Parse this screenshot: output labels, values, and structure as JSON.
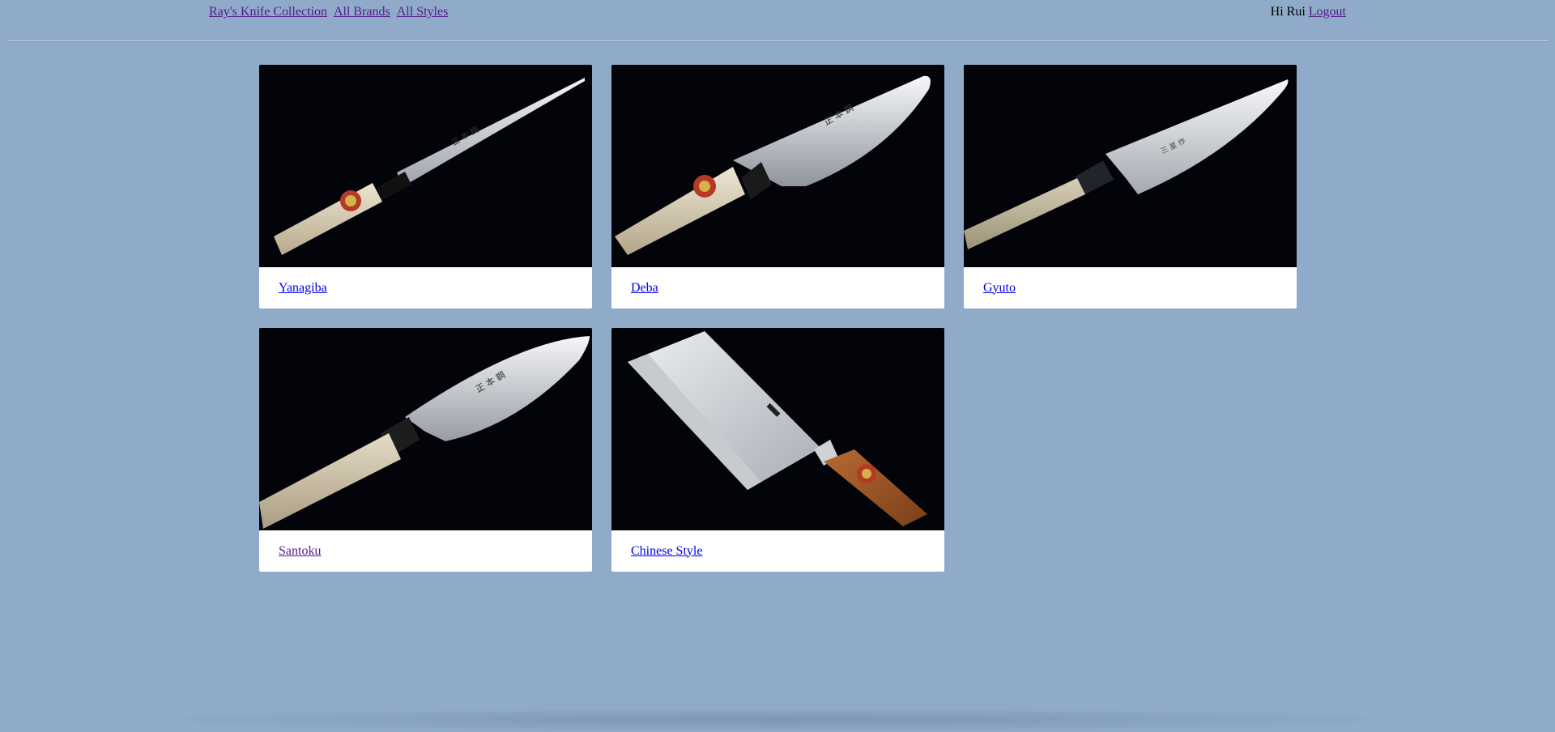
{
  "nav": {
    "brand": "Ray's Knife Collection",
    "brands": "All Brands",
    "styles": "All Styles"
  },
  "user": {
    "greeting": "Hi Rui",
    "logout": "Logout"
  },
  "cards": [
    {
      "label": "Yanagiba"
    },
    {
      "label": "Deba"
    },
    {
      "label": "Gyuto"
    },
    {
      "label": "Santoku"
    },
    {
      "label": "Chinese Style"
    }
  ],
  "colors": {
    "background": "#8fabc9",
    "link": "#0000ee",
    "visited_link": "#551a8b",
    "image_background": "#03040a"
  }
}
